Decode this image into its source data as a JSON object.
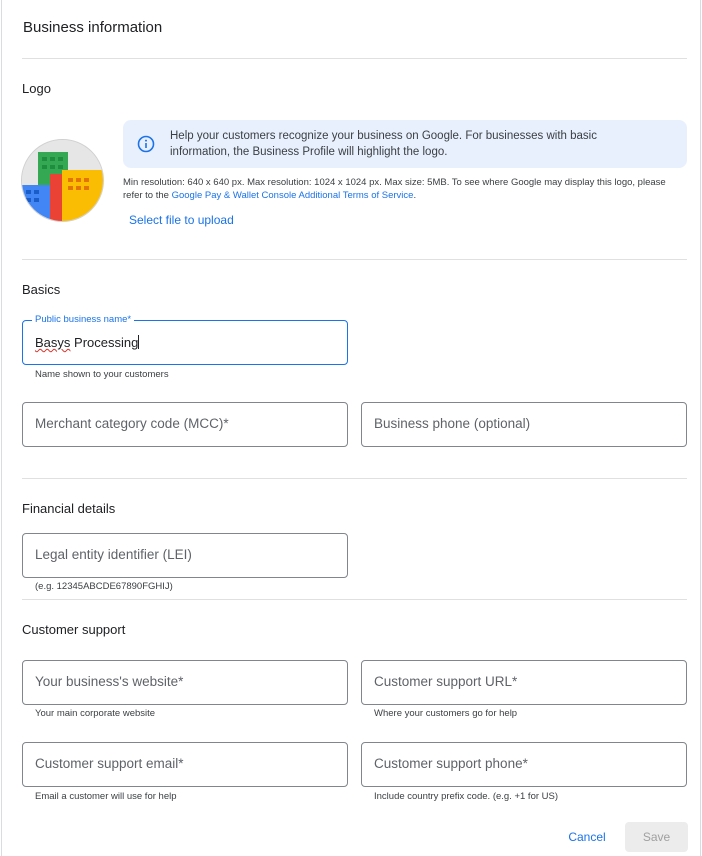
{
  "page_title": "Business information",
  "logo": {
    "section_title": "Logo",
    "info": "Help your customers recognize your business on Google. For businesses with basic information, the Business Profile will highlight the logo.",
    "requirements_prefix": "Min resolution: 640 x 640 px. Max resolution: 1024 x 1024 px. Max size: 5MB. To see where Google may display this logo, please refer to the",
    "terms_link": "Google Pay & Wallet Console Additional Terms of Service",
    "requirements_suffix": ".",
    "upload_label": "Select file to upload",
    "icon": "building-logo-icon"
  },
  "basics": {
    "section_title": "Basics",
    "business_name": {
      "label": "Public business name*",
      "value_misspelled": "Basys",
      "value_rest": " Processing",
      "helper": "Name shown to your customers"
    },
    "mcc": {
      "placeholder": "Merchant category code (MCC)*"
    },
    "phone": {
      "placeholder": "Business phone (optional)"
    }
  },
  "financial": {
    "section_title": "Financial details",
    "lei": {
      "placeholder": "Legal entity identifier (LEI)",
      "helper": "(e.g. 12345ABCDE67890FGHIJ)"
    }
  },
  "support": {
    "section_title": "Customer support",
    "website": {
      "placeholder": "Your business's website*",
      "helper": "Your main corporate website"
    },
    "support_url": {
      "placeholder": "Customer support URL*",
      "helper": "Where your customers go for help"
    },
    "support_email": {
      "placeholder": "Customer support email*",
      "helper": "Email a customer will use for help"
    },
    "support_phone": {
      "placeholder": "Customer support phone*",
      "helper": "Include country prefix code. (e.g. +1 for US)"
    }
  },
  "actions": {
    "cancel": "Cancel",
    "save": "Save"
  },
  "colors": {
    "accent": "#1a73e8",
    "info_bg": "#e8f0fe",
    "border": "#80868b"
  }
}
